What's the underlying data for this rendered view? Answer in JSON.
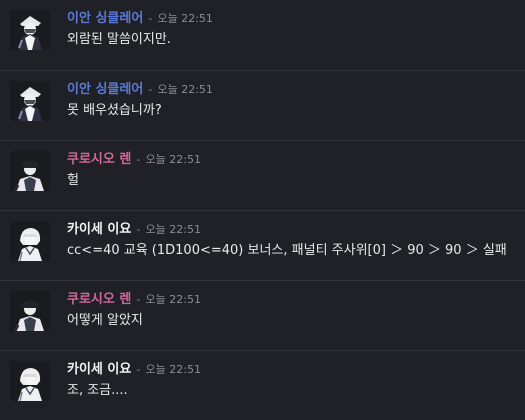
{
  "colors": {
    "background": "#202126",
    "name_blue": "#5b79d8",
    "name_pink": "#d0689c",
    "name_white": "#f2f2f2",
    "timestamp": "#8a8c93"
  },
  "separator": "-",
  "messages": [
    {
      "author": "이안 싱클레어",
      "time": "오늘 22:51",
      "text": "외람된 말씀이지만.",
      "name_color": "#5b79d8",
      "avatar": "avatar-ian-icon"
    },
    {
      "author": "이안 싱클레어",
      "time": "오늘 22:51",
      "text": "못 배우셨습니까?",
      "name_color": "#5b79d8",
      "avatar": "avatar-ian-icon"
    },
    {
      "author": "쿠로시오 렌",
      "time": "오늘 22:51",
      "text": "헐",
      "name_color": "#d0689c",
      "avatar": "avatar-ren-icon"
    },
    {
      "author": "카이세 이요",
      "time": "오늘 22:51",
      "text": "cc<=40 교육 (1D100<=40) 보너스, 패널티 주사위[0] ＞ 90 ＞ 90 ＞ 실패",
      "name_color": "#f2f2f2",
      "avatar": "avatar-iyo-icon"
    },
    {
      "author": "쿠로시오 렌",
      "time": "오늘 22:51",
      "text": "어떻게 알았지",
      "name_color": "#d0689c",
      "avatar": "avatar-ren-icon"
    },
    {
      "author": "카이세 이요",
      "time": "오늘 22:51",
      "text": "조, 조금....",
      "name_color": "#f2f2f2",
      "avatar": "avatar-iyo-icon"
    }
  ]
}
